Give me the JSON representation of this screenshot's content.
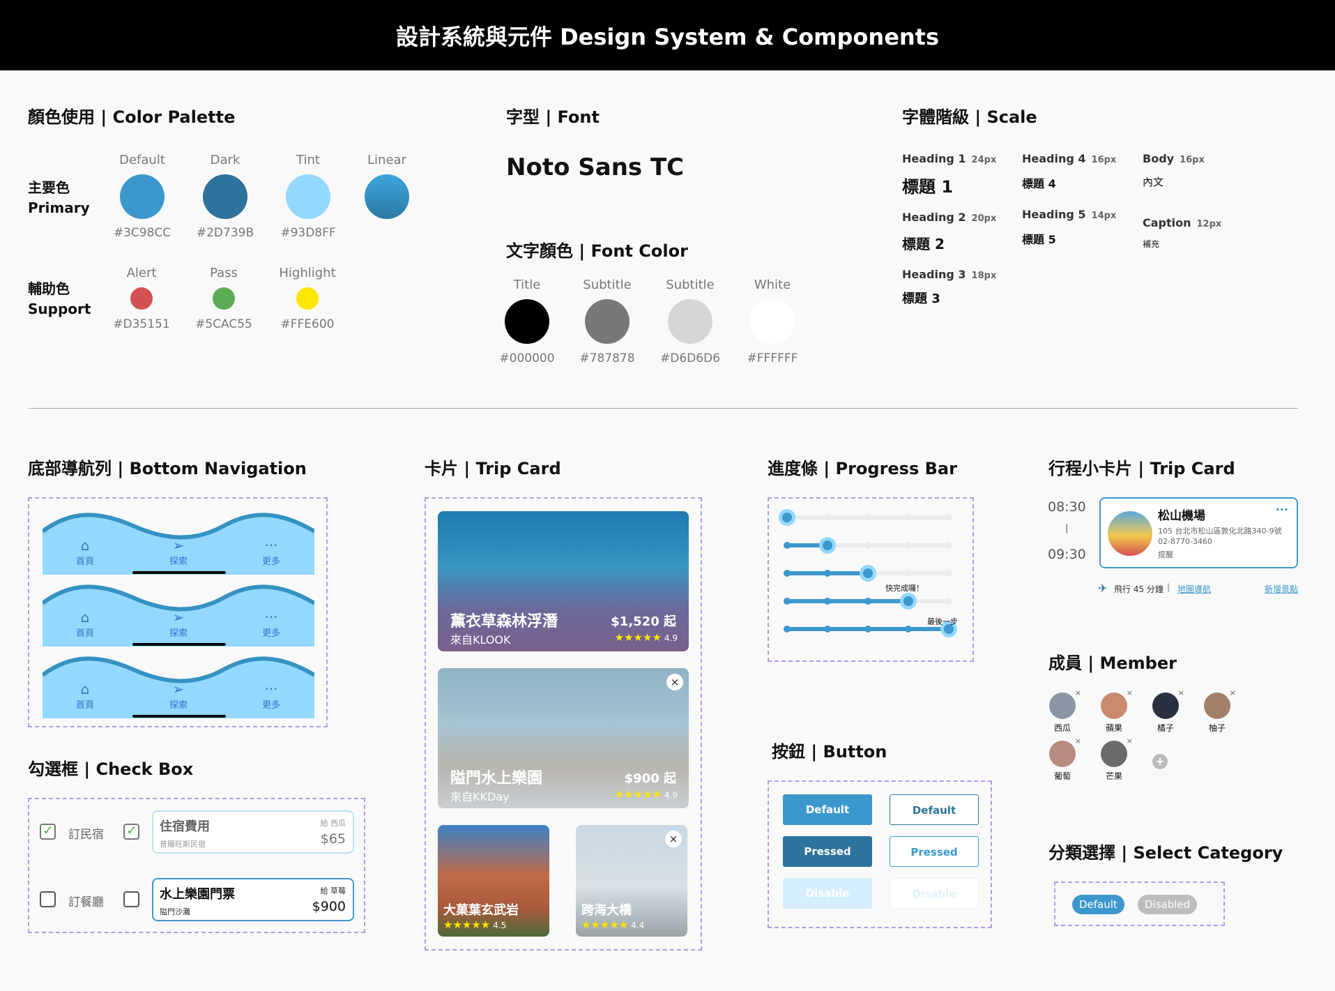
{
  "header": {
    "title": "設計系統與元件 Design System & Components"
  },
  "palette": {
    "title": "顏色使用 | Color Palette",
    "primary_label": [
      "主要色",
      "Primary"
    ],
    "support_label": [
      "輔助色",
      "Support"
    ],
    "primary": [
      {
        "name": "Default",
        "hex": "#3C98CC",
        "color": "#3C98CC"
      },
      {
        "name": "Dark",
        "hex": "#2D739B",
        "color": "#2D739B"
      },
      {
        "name": "Tint",
        "hex": "#93D8FF",
        "color": "#93D8FF"
      },
      {
        "name": "Linear",
        "hex": "",
        "color": "#3592c2"
      }
    ],
    "support": [
      {
        "name": "Alert",
        "hex": "#D35151",
        "color": "#D35151"
      },
      {
        "name": "Pass",
        "hex": "#5CAC55",
        "color": "#5CAC55"
      },
      {
        "name": "Highlight",
        "hex": "#FFE600",
        "color": "#FFE600"
      }
    ]
  },
  "font": {
    "title": "字型 | Font",
    "family_name": "Noto Sans TC",
    "color_title": "文字顏色 | Font Color",
    "colors": [
      {
        "name": "Title",
        "hex": "#000000",
        "color": "#000000"
      },
      {
        "name": "Subtitle",
        "hex": "#787878",
        "color": "#787878"
      },
      {
        "name": "Subtitle",
        "hex": "#D6D6D6",
        "color": "#D6D6D6"
      },
      {
        "name": "White",
        "hex": "#FFFFFF",
        "color": "#FFFFFF"
      }
    ]
  },
  "scale": {
    "title": "字體階級 | Scale",
    "items": [
      {
        "label": "Heading 1",
        "size": "24px",
        "sample": "標題 1"
      },
      {
        "label": "Heading 2",
        "size": "20px",
        "sample": "標題 2"
      },
      {
        "label": "Heading 3",
        "size": "18px",
        "sample": "標題 3"
      },
      {
        "label": "Heading 4",
        "size": "16px",
        "sample": "標題 4"
      },
      {
        "label": "Heading 5",
        "size": "14px",
        "sample": "標題 5"
      },
      {
        "label": "Body",
        "size": "16px",
        "sample": "內文"
      },
      {
        "label": "Caption",
        "size": "12px",
        "sample": "補充"
      }
    ]
  },
  "bottom_nav": {
    "title": "底部導航列 | Bottom Navigation",
    "items": [
      "首頁",
      "探索",
      "更多"
    ],
    "bars": [
      {
        "active": "explore"
      },
      {
        "active": "explore"
      },
      {
        "active": "explore"
      }
    ]
  },
  "checkbox": {
    "title": "勾選框 | Check Box",
    "row1": {
      "label": "訂民宿",
      "card_title": "住宿費用",
      "card_sub": "普羅旺斯民宿",
      "payer": "給 西瓜",
      "amount": "$65"
    },
    "row2": {
      "label": "訂餐廳",
      "card_title": "水上樂園門票",
      "card_sub": "隘門沙灘",
      "payer": "給 草莓",
      "amount": "$900"
    }
  },
  "trip_card": {
    "title": "卡片 | Trip Card",
    "cards": [
      {
        "name": "薰衣草森林浮潛",
        "source": "來自KLOOK",
        "price": "$1,520 起",
        "rating": "4.9"
      },
      {
        "name": "隘門水上樂園",
        "source": "來自KKDay",
        "price": "$900 起",
        "rating": "4.9"
      },
      {
        "name": "大菓葉玄武岩",
        "rating": "4.5"
      },
      {
        "name": "跨海大橋",
        "rating": "4.4"
      }
    ],
    "close_glyph": "×",
    "stars": "★★★★★"
  },
  "progress": {
    "title": "進度條 | Progress Bar",
    "rows": [
      {
        "step": 1,
        "total": 5,
        "note": ""
      },
      {
        "step": 2,
        "total": 5,
        "note": ""
      },
      {
        "step": 3,
        "total": 5,
        "note": ""
      },
      {
        "step": 4,
        "total": 5,
        "note": "快完成囉！"
      },
      {
        "step": 5,
        "total": 5,
        "note": "最後一步"
      }
    ]
  },
  "buttons": {
    "title": "按鈕 | Button",
    "labels": {
      "default": "Default",
      "pressed": "Pressed",
      "disable": "Disable"
    }
  },
  "mini_card": {
    "title": "行程小卡片 | Trip Card",
    "start": "08:30",
    "sep": "|",
    "end": "09:30",
    "place": "松山機場",
    "address": "105 台北市松山區敦化北路340-9號",
    "phone": "02-8770-3460",
    "note": "提醒",
    "more": "···",
    "travel": "飛行 45 分鐘",
    "bar": "|",
    "map_link": "地圖導航",
    "add_link": "新增景點"
  },
  "member": {
    "title": "成員 | Member",
    "people": [
      {
        "name": "西瓜",
        "color": "#8a96a3"
      },
      {
        "name": "蘋果",
        "color": "#c98a6e"
      },
      {
        "name": "橘子",
        "color": "#2a3040"
      },
      {
        "name": "柚子",
        "color": "#a0806a"
      },
      {
        "name": "葡萄",
        "color": "#b98a80"
      },
      {
        "name": "芒果",
        "color": "#6a6a6a"
      }
    ],
    "add_glyph": "+"
  },
  "category": {
    "title": "分類選擇 | Select Category",
    "default": "Default",
    "disabled": "Disabled"
  }
}
